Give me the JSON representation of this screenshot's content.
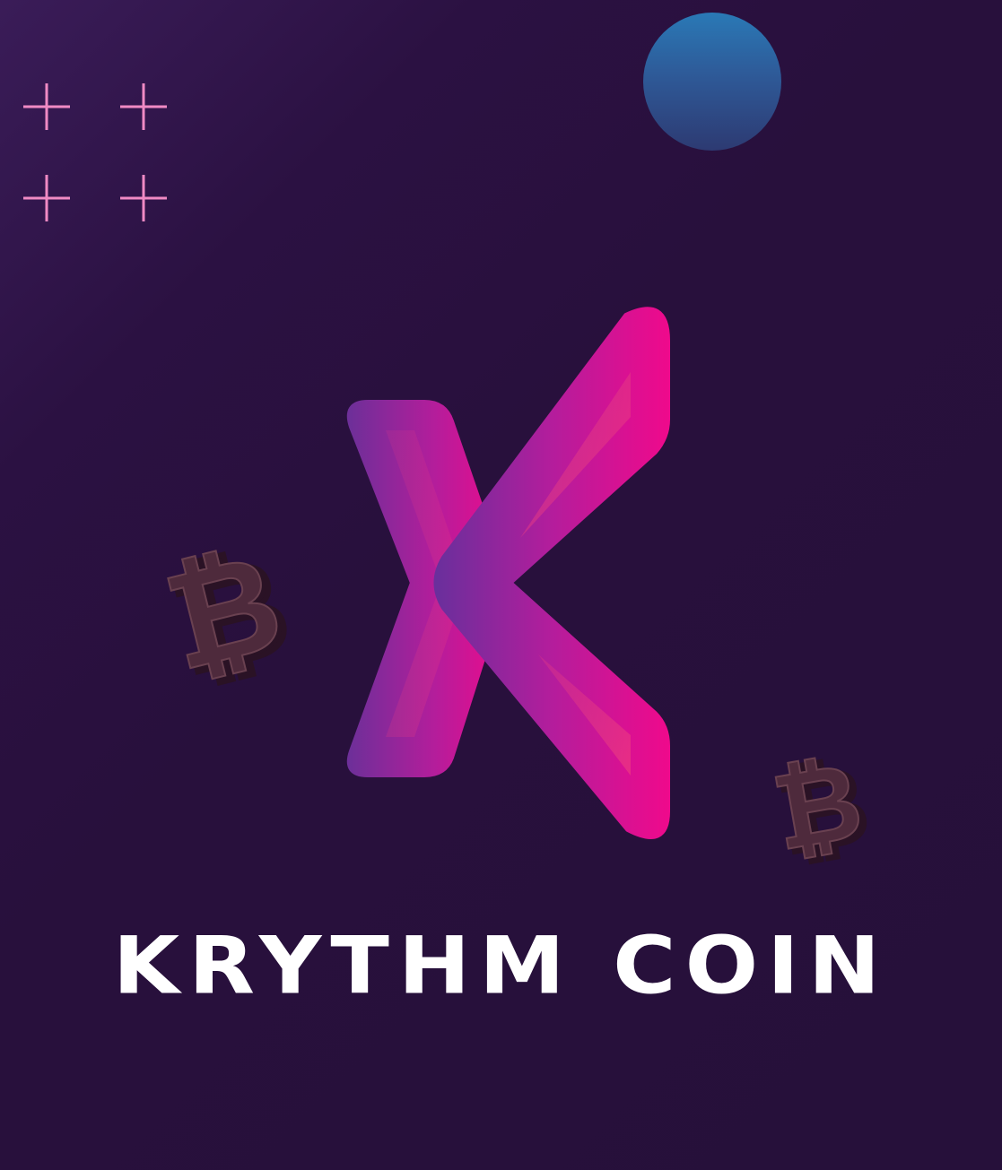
{
  "brand": {
    "name": "KRYTHM COIN",
    "logo_letter": "X",
    "bitcoin_symbol": "₿"
  },
  "colors": {
    "background": "#28103c",
    "plus_marks": "#f08ac4",
    "orb": "#2a79b6",
    "logo_gradient_start": "#6e2f99",
    "logo_gradient_end": "#ee0a8c",
    "bitcoin_coin": "#4a2a3a",
    "title": "#ffffff"
  },
  "icons": [
    "plus-icon",
    "orb-icon",
    "x-logo-icon",
    "bitcoin-icon"
  ]
}
